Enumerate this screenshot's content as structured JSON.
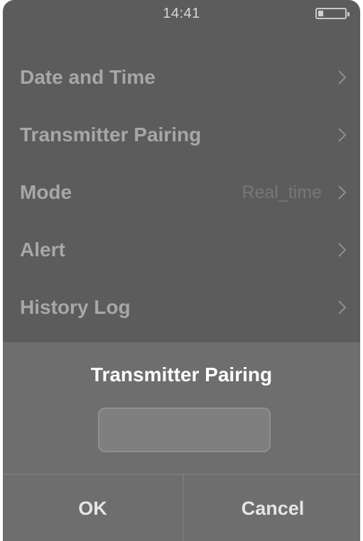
{
  "status_bar": {
    "time": "14:41",
    "icons": {
      "back": "back-arrow-icon",
      "battery": "battery-icon"
    },
    "battery_level": 0.2
  },
  "menu": {
    "items": [
      {
        "label": "Date and Time",
        "value": ""
      },
      {
        "label": "Transmitter Pairing",
        "value": ""
      },
      {
        "label": "Mode",
        "value": "Real_time"
      },
      {
        "label": "Alert",
        "value": ""
      },
      {
        "label": "History Log",
        "value": ""
      }
    ],
    "chevron_icon": "chevron-right-icon"
  },
  "dialog": {
    "title": "Transmitter Pairing",
    "input_value": "",
    "ok_label": "OK",
    "cancel_label": "Cancel"
  }
}
